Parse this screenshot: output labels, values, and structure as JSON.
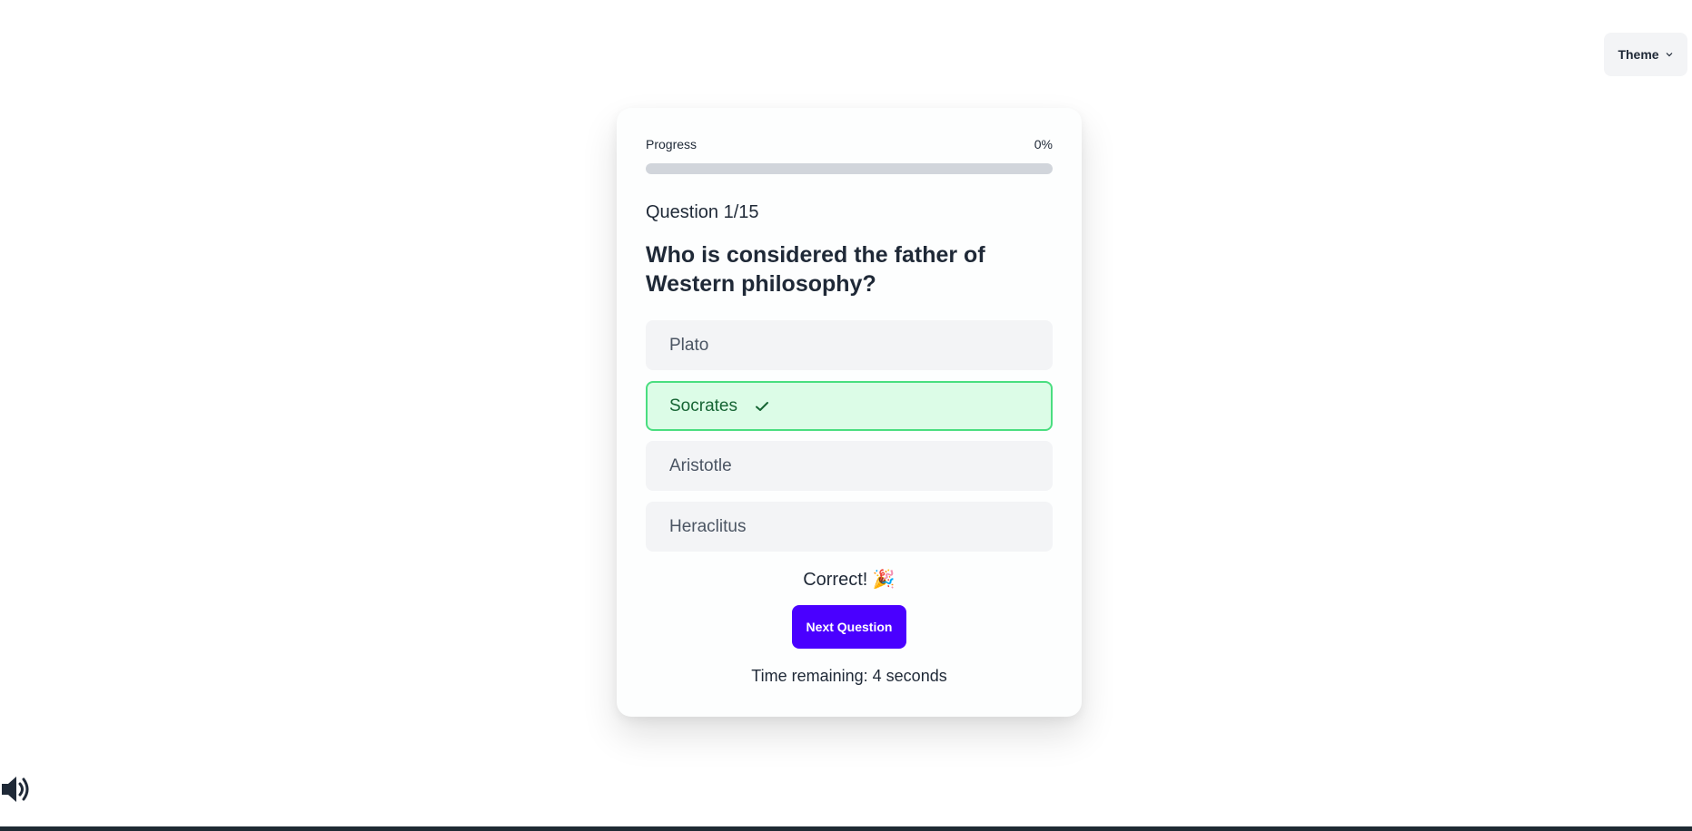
{
  "header": {
    "theme_label": "Theme",
    "theme_icon": "chevron-down-icon"
  },
  "quiz": {
    "progress_label": "Progress",
    "progress_percent_text": "0%",
    "progress_fraction": 0,
    "question_number": "Question 1/15",
    "question_text": "Who is considered the father of Western philosophy?",
    "options": [
      {
        "label": "Plato",
        "state": "default"
      },
      {
        "label": "Socrates",
        "state": "correct"
      },
      {
        "label": "Aristotle",
        "state": "default"
      },
      {
        "label": "Heraclitus",
        "state": "default"
      }
    ],
    "feedback": "Correct! 🎉",
    "next_button": "Next Question",
    "timer_text": "Time remaining: 4 seconds"
  },
  "footer": {
    "sound_icon": "speaker-icon"
  },
  "colors": {
    "accent": "#4a00ff",
    "correct_bg": "#dcfce7",
    "correct_border": "#4ade80",
    "correct_text": "#166534",
    "option_bg": "#f3f4f6",
    "bottom_bar": "#1e2a33"
  }
}
